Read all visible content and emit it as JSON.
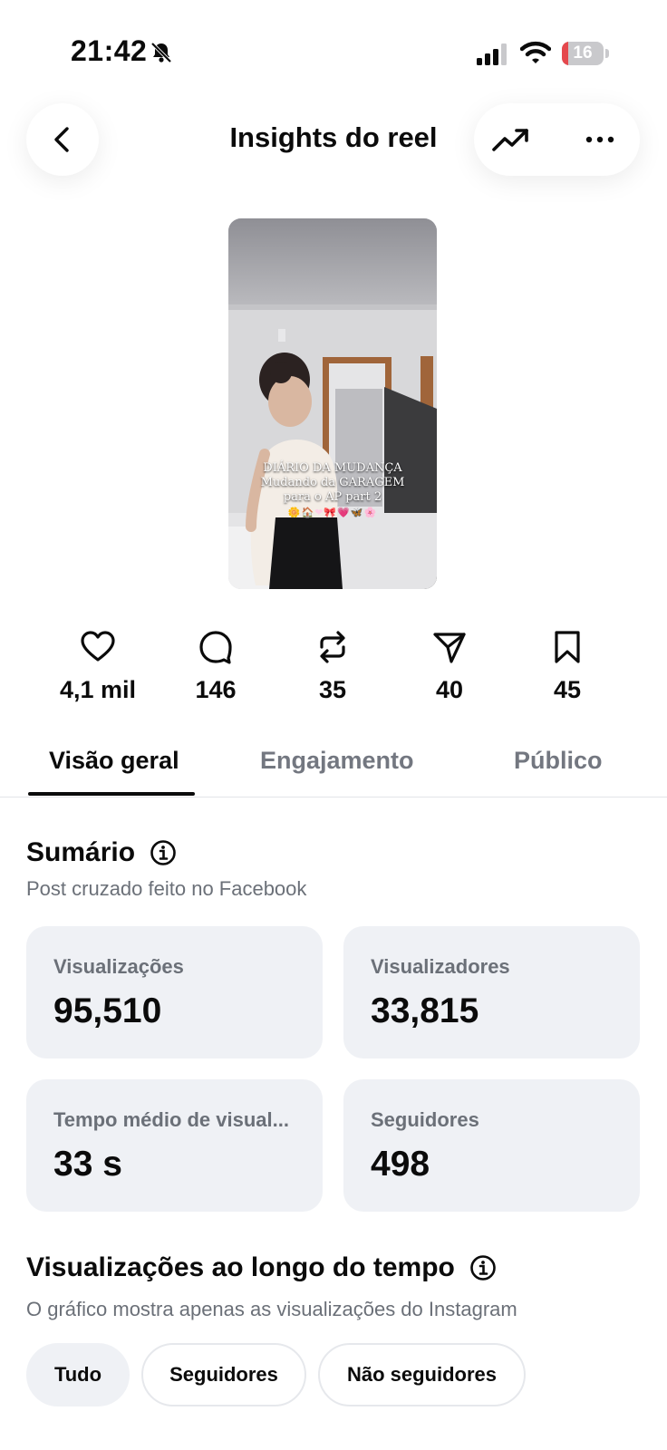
{
  "status_bar": {
    "time": "21:42",
    "battery": "16",
    "battery_level": 0.16,
    "icons": [
      "bell-slash-icon",
      "signal-icon",
      "wifi-icon",
      "battery-icon"
    ]
  },
  "header": {
    "title": "Insights do reel",
    "back_icon": "chevron-left-icon",
    "trend_icon": "trending-up-icon",
    "more_icon": "more-horizontal-icon"
  },
  "reel": {
    "caption_lines": [
      "DIÁRIO DA MUDANÇA",
      "Mudando da GARAGEM",
      "para o AP part 2"
    ],
    "caption_emoji": "🌼🏠❤🎀💗🦋🌸"
  },
  "stats": [
    {
      "icon": "heart-icon",
      "value": "4,1 mil"
    },
    {
      "icon": "comment-icon",
      "value": "146"
    },
    {
      "icon": "repost-icon",
      "value": "35"
    },
    {
      "icon": "send-icon",
      "value": "40"
    },
    {
      "icon": "bookmark-icon",
      "value": "45"
    }
  ],
  "tabs": [
    {
      "label": "Visão geral",
      "active": true
    },
    {
      "label": "Engajamento",
      "active": false
    },
    {
      "label": "Público",
      "active": false
    }
  ],
  "summary": {
    "title": "Sumário",
    "subtitle": "Post cruzado feito no Facebook",
    "cards": [
      {
        "label": "Visualizações",
        "value": "95,510"
      },
      {
        "label": "Visualizadores",
        "value": "33,815"
      },
      {
        "label": "Tempo médio de visual...",
        "value": "33 s"
      },
      {
        "label": "Seguidores",
        "value": "498"
      }
    ]
  },
  "views_over_time": {
    "title": "Visualizações ao longo do tempo",
    "subtitle": "O gráfico mostra apenas as visualizações do Instagram",
    "filters": [
      {
        "label": "Tudo",
        "active": true
      },
      {
        "label": "Seguidores",
        "active": false
      },
      {
        "label": "Não seguidores",
        "active": false
      }
    ]
  },
  "colors": {
    "text": "#0b0b0b",
    "muted": "#6b7078",
    "card_bg": "#eff1f5",
    "battery_red": "#e5484d"
  }
}
